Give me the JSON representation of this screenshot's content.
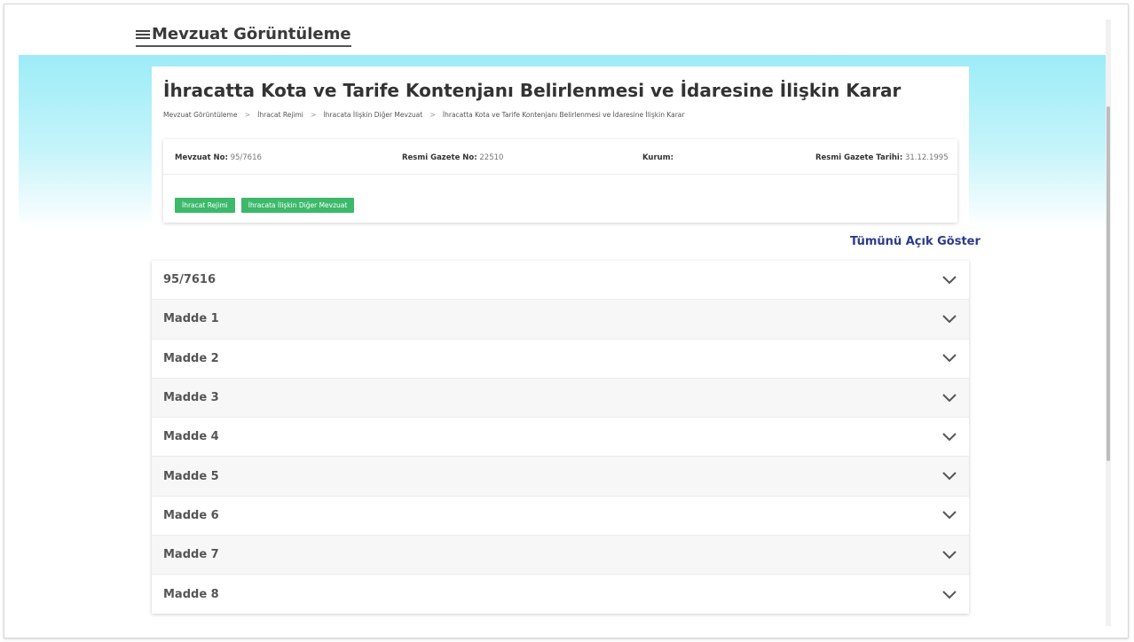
{
  "header": {
    "title": "Mevzuat Görüntüleme"
  },
  "document": {
    "title": "İhracatta Kota ve Tarife Kontenjanı Belirlenmesi ve İdaresine İlişkin Karar",
    "breadcrumb": [
      "Mevzuat Görüntüleme",
      "İhracat Rejimi",
      "İhracata İlişkin Diğer Mevzuat",
      "İhracatta Kota ve Tarife Kontenjanı Belirlenmesi ve İdaresine İlişkin Karar"
    ]
  },
  "info": {
    "mevzuat_no_label": "Mevzuat No:",
    "mevzuat_no_value": "95/7616",
    "gazete_no_label": "Resmi Gazete No:",
    "gazete_no_value": "22510",
    "kurum_label": "Kurum:",
    "kurum_value": "",
    "gazete_tarihi_label": "Resmi Gazete Tarihi:",
    "gazete_tarihi_value": "31.12.1995",
    "tags": [
      "İhracat Rejimi",
      "İhracata İlişkin Diğer Mevzuat"
    ]
  },
  "show_all_label": "Tümünü Açık Göster",
  "sections": [
    "95/7616",
    "Madde 1",
    "Madde 2",
    "Madde 3",
    "Madde 4",
    "Madde 5",
    "Madde 6",
    "Madde 7",
    "Madde 8"
  ],
  "colors": {
    "accent_green": "#3cb96a",
    "link_blue": "#2b3a8c",
    "hero_cyan": "#9cecf7"
  },
  "icons": {
    "menu": "hamburger-icon",
    "chevron": "chevron-down-icon"
  }
}
